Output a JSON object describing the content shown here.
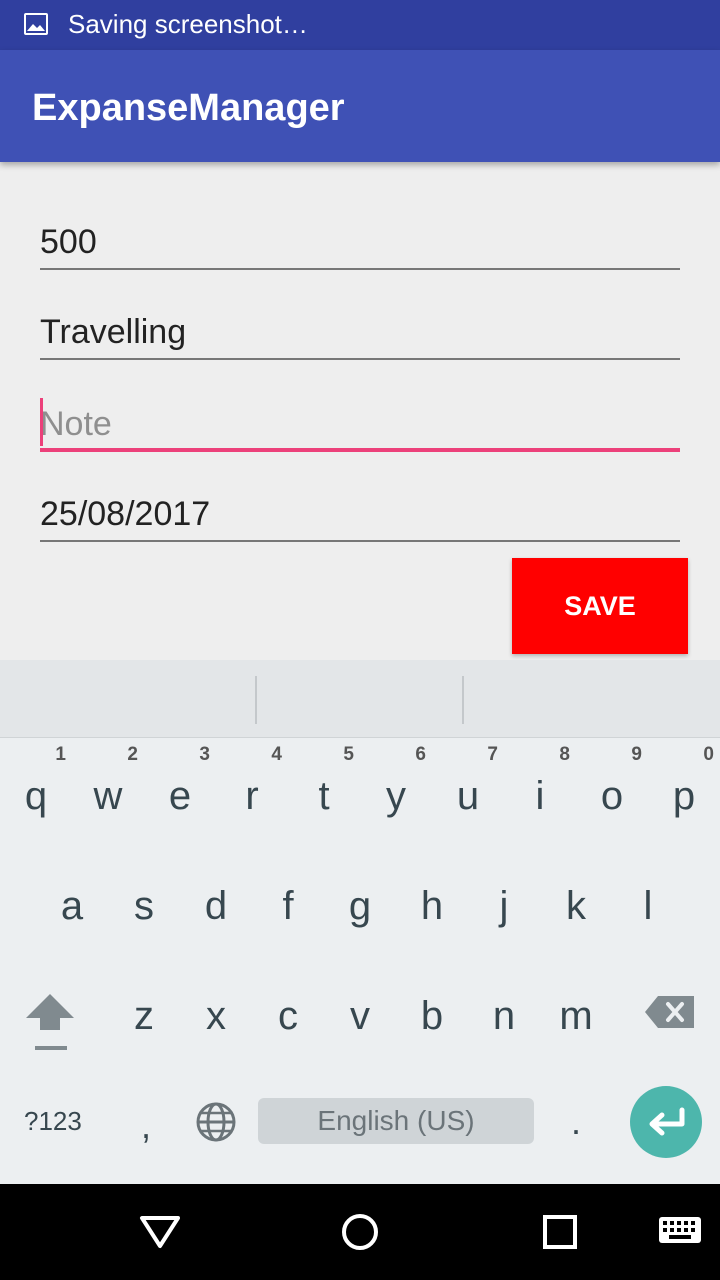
{
  "status_bar": {
    "text": "Saving screenshot…",
    "icon": "image-icon"
  },
  "app_bar": {
    "title": "ExpanseManager"
  },
  "form": {
    "amount": {
      "value": "500"
    },
    "category": {
      "value": "Travelling"
    },
    "note": {
      "placeholder": "Note",
      "value": ""
    },
    "date": {
      "value": "25/08/2017"
    },
    "save_label": "SAVE"
  },
  "colors": {
    "primary": "#3f51b5",
    "primary_dark": "#303f9f",
    "accent": "#ec407a",
    "save": "#ff0000",
    "enter": "#4db6ac"
  },
  "keyboard": {
    "row1": [
      {
        "ch": "q",
        "hint": "1"
      },
      {
        "ch": "w",
        "hint": "2"
      },
      {
        "ch": "e",
        "hint": "3"
      },
      {
        "ch": "r",
        "hint": "4"
      },
      {
        "ch": "t",
        "hint": "5"
      },
      {
        "ch": "y",
        "hint": "6"
      },
      {
        "ch": "u",
        "hint": "7"
      },
      {
        "ch": "i",
        "hint": "8"
      },
      {
        "ch": "o",
        "hint": "9"
      },
      {
        "ch": "p",
        "hint": "0"
      }
    ],
    "row2": [
      "a",
      "s",
      "d",
      "f",
      "g",
      "h",
      "j",
      "k",
      "l"
    ],
    "row3": [
      "z",
      "x",
      "c",
      "v",
      "b",
      "n",
      "m"
    ],
    "symbols_label": "?123",
    "comma": ",",
    "space_label": "English (US)",
    "period": "."
  }
}
